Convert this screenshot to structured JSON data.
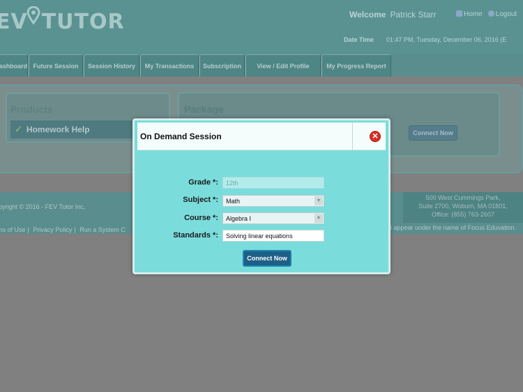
{
  "header": {
    "logo_left": "EV",
    "logo_right": "TUTOR",
    "welcome_label": "Welcome",
    "user_name": "Patrick Starr",
    "home_link": "Home",
    "logout_link": "Logout",
    "date_label": "Date Time",
    "date_value": "01:47 PM, Tuesday, December 06, 2016 (E"
  },
  "nav": {
    "tabs": [
      {
        "label": "ashboard"
      },
      {
        "label": "Future Session"
      },
      {
        "label": "Session History"
      },
      {
        "label": "My Transactions"
      },
      {
        "label": "Subscription"
      },
      {
        "label": "View / Edit Profile"
      },
      {
        "label": "My Progress Report"
      }
    ]
  },
  "products": {
    "title": "Products",
    "item": "Homework Help"
  },
  "package": {
    "title": "Package",
    "connect_label": "Connect Now"
  },
  "footer": {
    "copyright": "pyright © 2016 - FEV Tutor Inc,",
    "terms": "ms of Use",
    "privacy": "Privacy Policy",
    "system_check": "Run a System C",
    "address_line1": "500 West Cummings Park,",
    "address_line2": "Suite 2700, Woburn, MA 01801,",
    "address_line3": "Office: (855) 763-2607",
    "note": "ill appear under the name of Focus Eduvation."
  },
  "modal": {
    "title": "On Demand Session",
    "close_glyph": "✕",
    "grade_label": "Grade *:",
    "grade_value": "12th",
    "subject_label": "Subject *:",
    "subject_value": "Math",
    "course_label": "Course *:",
    "course_value": "Algebra I",
    "standards_label": "Standards *:",
    "standards_value": "Solving linear equations",
    "connect_label": "Connect Now"
  },
  "colors": {
    "modal_bg": "#7bdcdc",
    "connect_button": "#1e5f86",
    "close_button": "#d93025"
  }
}
